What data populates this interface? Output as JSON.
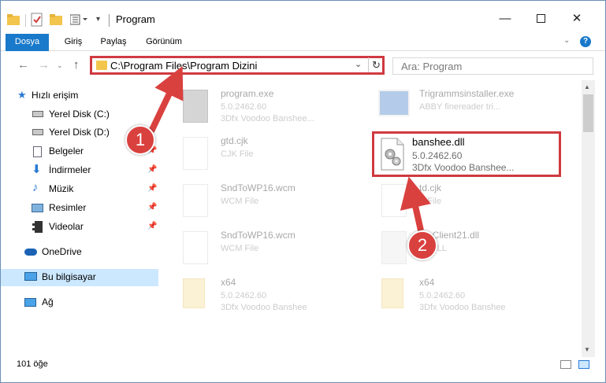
{
  "window": {
    "title": "Program",
    "minimize_icon": "minimize-icon",
    "maximize_icon": "maximize-icon",
    "close_icon": "close-icon"
  },
  "ribbon": {
    "tabs": [
      {
        "label": "Dosya"
      },
      {
        "label": "Giriş"
      },
      {
        "label": "Paylaş"
      },
      {
        "label": "Görünüm"
      }
    ],
    "help_label": "?"
  },
  "address": {
    "path": "C:\\Program Files\\Program Dizini",
    "search_placeholder": "Ara: Program"
  },
  "nav": {
    "items": [
      {
        "label": "Hızlı erişim",
        "icon": "star-icon"
      },
      {
        "label": "Yerel Disk (C:)",
        "icon": "drive-icon"
      },
      {
        "label": "Yerel Disk (D:)",
        "icon": "drive-icon"
      },
      {
        "label": "Belgeler",
        "icon": "documents-icon"
      },
      {
        "label": "İndirmeler",
        "icon": "download-icon"
      },
      {
        "label": "Müzik",
        "icon": "music-icon"
      },
      {
        "label": "Resimler",
        "icon": "pictures-icon"
      },
      {
        "label": "Videolar",
        "icon": "video-icon"
      },
      {
        "label": "OneDrive",
        "icon": "cloud-icon"
      },
      {
        "label": "Bu bilgisayar",
        "icon": "computer-icon"
      },
      {
        "label": "Ağ",
        "icon": "network-icon"
      }
    ]
  },
  "files": [
    {
      "name": "program.exe",
      "line2": "5.0.2462.60",
      "line3": "3Dfx Voodoo Banshee..."
    },
    {
      "name": "Trigrammsinstaller.exe",
      "line2": "ABBY finereader tri...",
      "line3": ""
    },
    {
      "name": "gtd.cjk",
      "line2": "CJK File",
      "line3": ""
    },
    {
      "name": "banshee.dll",
      "line2": "5.0.2462.60",
      "line3": "3Dfx Voodoo Banshee..."
    },
    {
      "name": "SndToWP16.wcm",
      "line2": "WCM File",
      "line3": ""
    },
    {
      "name": "td.cjk",
      "line2": "K File",
      "line3": ""
    },
    {
      "name": "SndToWP16.wcm",
      "line2": "WCM File",
      "line3": ""
    },
    {
      "name": "ateClient21.dll",
      "line2": "ce DLL",
      "line3": ""
    },
    {
      "name": "x64",
      "line2": "5.0.2462.60",
      "line3": "3Dfx Voodoo Banshee"
    },
    {
      "name": "x64",
      "line2": "5.0.2462.60",
      "line3": "3Dfx Voodoo Banshee"
    }
  ],
  "status": {
    "count": "101 öğe"
  },
  "annotations": {
    "step1": "1",
    "step2": "2",
    "accent": "#d9413f"
  }
}
